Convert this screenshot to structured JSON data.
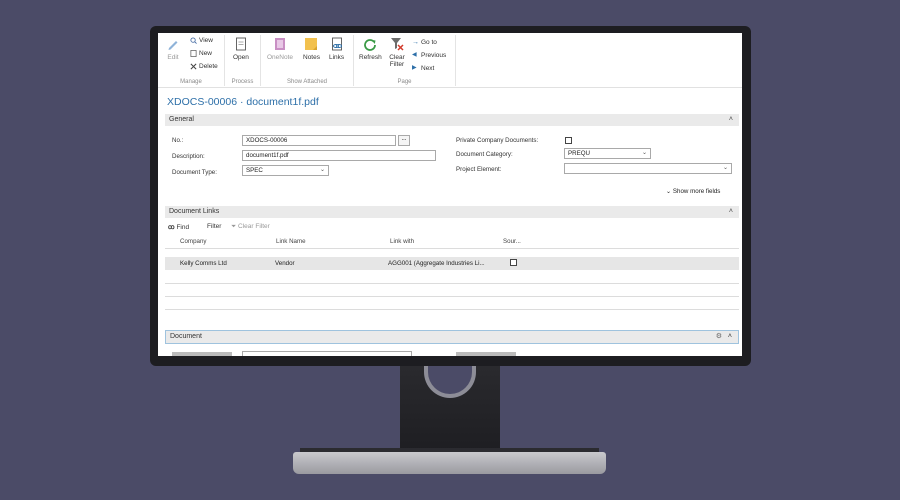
{
  "ribbon": {
    "manage": {
      "label": "Manage",
      "edit": "Edit",
      "view": "View",
      "new": "New",
      "delete": "Delete"
    },
    "process": {
      "label": "Process",
      "open": "Open"
    },
    "show_attached": {
      "label": "Show Attached",
      "onenote": "OneNote",
      "notes": "Notes",
      "links": "Links"
    },
    "page": {
      "label": "Page",
      "refresh": "Refresh",
      "clear_filter": "Clear Filter",
      "go_to": "Go to",
      "previous": "Previous",
      "next": "Next"
    }
  },
  "page_title": "XDOCS-00006 · document1f.pdf",
  "general": {
    "header": "General",
    "no_label": "No.:",
    "no_value": "XDOCS-00006",
    "description_label": "Description:",
    "description_value": "document1f.pdf",
    "doc_type_label": "Document Type:",
    "doc_type_value": "SPEC",
    "private_label": "Private Company Documents:",
    "category_label": "Document Category:",
    "category_value": "PREQU",
    "project_label": "Project Element:",
    "project_value": "",
    "show_more": "Show more fields"
  },
  "links": {
    "header": "Document Links",
    "find": "Find",
    "filter": "Filter",
    "clear_filter": "Clear Filter",
    "columns": [
      "Company",
      "Link Name",
      "Link with",
      "Sour..."
    ],
    "rows": [
      {
        "company": "Kelly Comms Ltd",
        "link_name": "Vendor",
        "link_with": "AGG001 (Aggregate Industries Li..."
      }
    ]
  },
  "document_section": {
    "header": "Document"
  },
  "colors": {
    "accent": "#2d6fa8",
    "background": "#4b4b67"
  }
}
